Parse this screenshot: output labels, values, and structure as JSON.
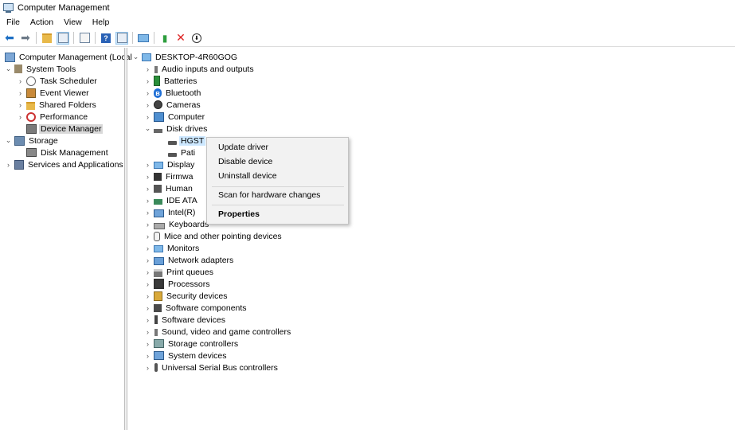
{
  "window": {
    "title": "Computer Management"
  },
  "menu": [
    "File",
    "Action",
    "View",
    "Help"
  ],
  "toolbar": {
    "icons": [
      "back-arrow-icon",
      "forward-arrow-icon",
      "up-folder-icon",
      "show-hide-console-tree-icon",
      "properties-icon",
      "help-icon",
      "show-hide-action-pane-icon",
      "monitor-icon",
      "enable-device-icon",
      "uninstall-device-icon",
      "download-driver-icon"
    ]
  },
  "left_tree": {
    "root": "Computer Management (Local",
    "system_tools": "System Tools",
    "task_scheduler": "Task Scheduler",
    "event_viewer": "Event Viewer",
    "shared_folders": "Shared Folders",
    "performance": "Performance",
    "device_manager": "Device Manager",
    "storage": "Storage",
    "disk_management": "Disk Management",
    "services_apps": "Services and Applications"
  },
  "device_tree": {
    "root": "DESKTOP-4R60GOG",
    "items": [
      "Audio inputs and outputs",
      "Batteries",
      "Bluetooth",
      "Cameras",
      "Computer",
      "Disk drives",
      "HGST",
      "Pati",
      "Display",
      "Firmwa",
      "Human",
      "IDE ATA",
      "Intel(R)",
      "Keyboards",
      "Mice and other pointing devices",
      "Monitors",
      "Network adapters",
      "Print queues",
      "Processors",
      "Security devices",
      "Software components",
      "Software devices",
      "Sound, video and game controllers",
      "Storage controllers",
      "System devices",
      "Universal Serial Bus controllers"
    ]
  },
  "context_menu": {
    "update_driver": "Update driver",
    "disable_device": "Disable device",
    "uninstall_device": "Uninstall device",
    "scan_hardware": "Scan for hardware changes",
    "properties": "Properties"
  }
}
